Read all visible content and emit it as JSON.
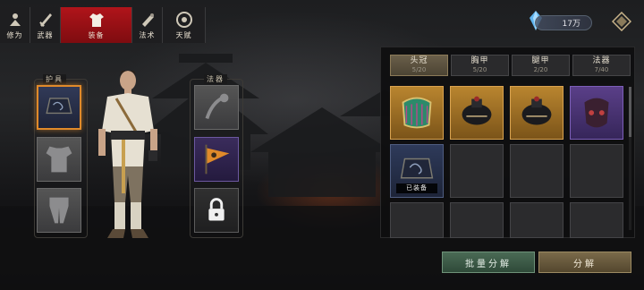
{
  "tabs": [
    {
      "label": "修为",
      "icon": "meditation-icon"
    },
    {
      "label": "武器",
      "icon": "sword-icon"
    },
    {
      "label": "装备",
      "icon": "robe-icon",
      "active": true
    },
    {
      "label": "法术",
      "icon": "scroll-icon"
    },
    {
      "label": "天赋",
      "icon": "talent-wheel-icon"
    }
  ],
  "currency": {
    "amount": "17万",
    "icon": "crystal-icon"
  },
  "sections": {
    "armor": "护具",
    "magic": "法器"
  },
  "inventory": {
    "categories": [
      {
        "name": "头冠",
        "count": "5/20",
        "active": true
      },
      {
        "name": "胸甲",
        "count": "5/20"
      },
      {
        "name": "腿甲",
        "count": "2/20"
      },
      {
        "name": "法器",
        "count": "7/40"
      }
    ],
    "equipped_tag": "已装备"
  },
  "buttons": {
    "batch_decompose": "批量分解",
    "decompose": "分解"
  },
  "colors": {
    "active_tab": "#b0141a",
    "selected_slot": "#e08a2a",
    "gold_rarity": "#b9852f",
    "purple_rarity": "#5a3f88"
  }
}
